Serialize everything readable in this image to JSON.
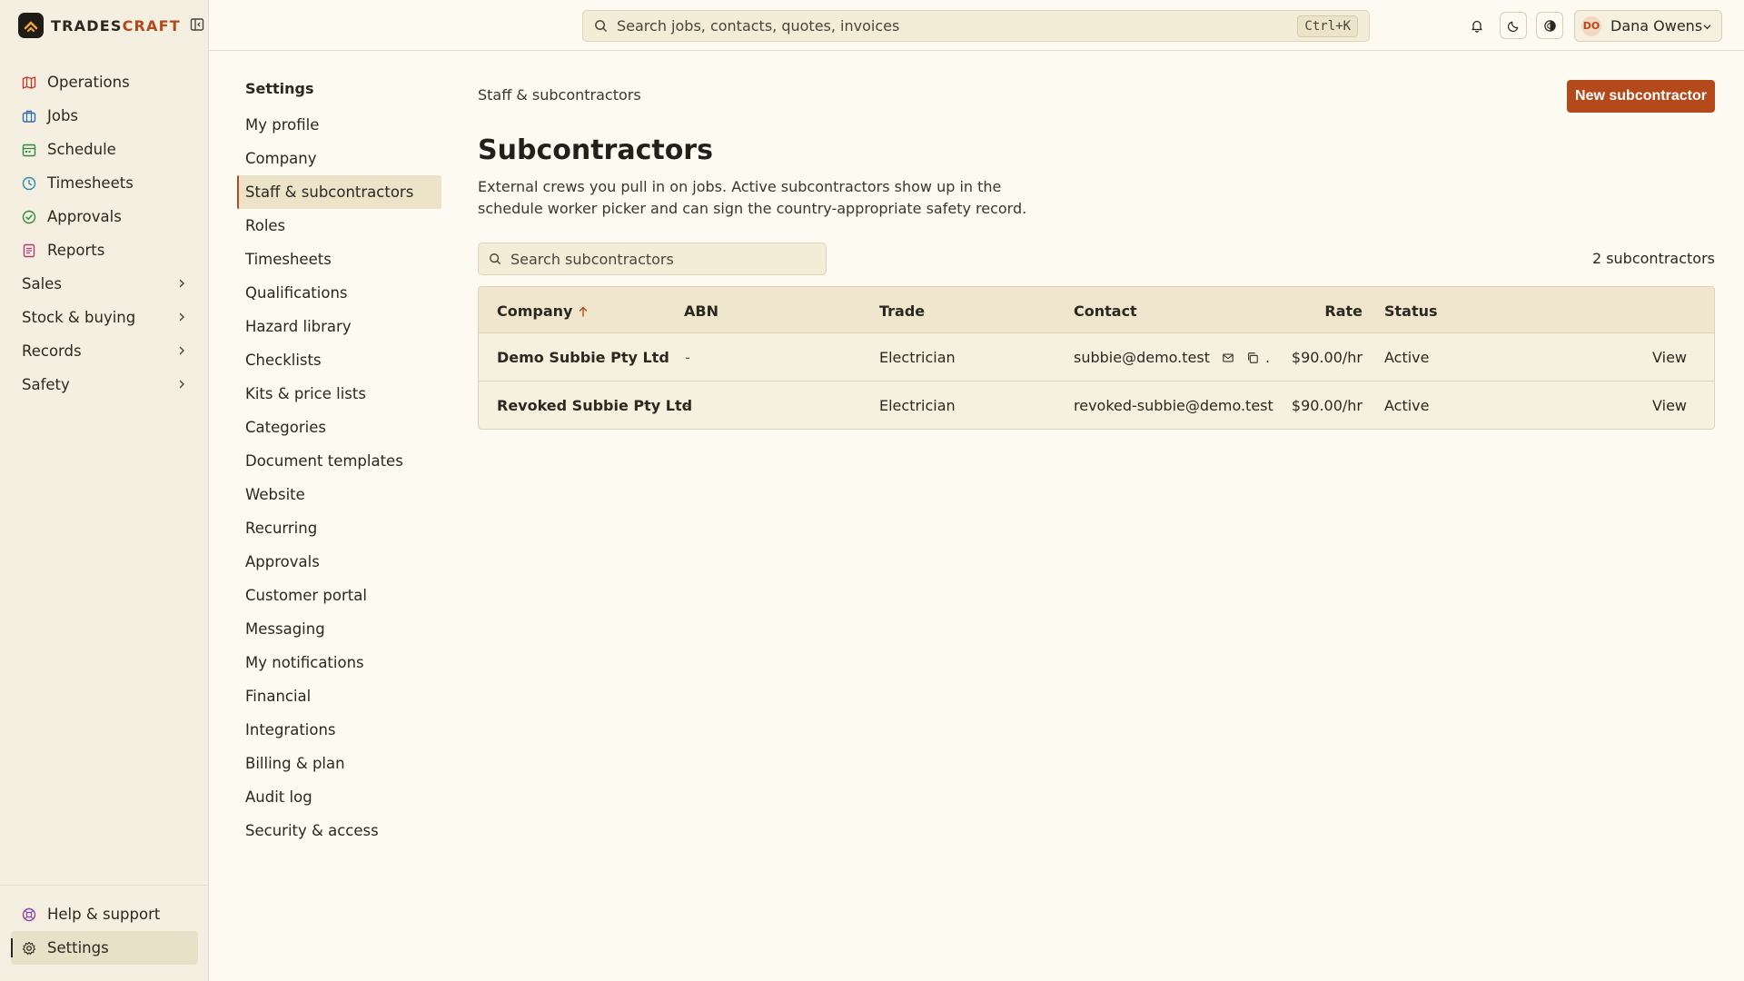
{
  "brand": {
    "name_primary": "TRADES",
    "name_accent": "CRAFT"
  },
  "sidebar": {
    "items": [
      {
        "label": "Operations",
        "icon": "map-icon",
        "color": "#c0392b"
      },
      {
        "label": "Jobs",
        "icon": "briefcase-icon",
        "color": "#2e6fb0"
      },
      {
        "label": "Schedule",
        "icon": "calendar-icon",
        "color": "#2e8b3d"
      },
      {
        "label": "Timesheets",
        "icon": "clock-icon",
        "color": "#2a8ca8"
      },
      {
        "label": "Approvals",
        "icon": "check-circle-icon",
        "color": "#2e8b3d"
      },
      {
        "label": "Reports",
        "icon": "report-icon",
        "color": "#b03a7a"
      },
      {
        "label": "Sales"
      },
      {
        "label": "Stock & buying"
      },
      {
        "label": "Records"
      },
      {
        "label": "Safety"
      }
    ],
    "bottom": [
      {
        "label": "Help & support",
        "icon": "lifebuoy-icon",
        "color": "#8a4bb0"
      },
      {
        "label": "Settings",
        "icon": "gear-icon",
        "color": "#3b372f"
      }
    ]
  },
  "topbar": {
    "search_placeholder": "Search jobs, contacts, quotes, invoices",
    "shortcut": "Ctrl+K",
    "user_initials": "DO",
    "user_name": "Dana Owens"
  },
  "settings_nav": {
    "title": "Settings",
    "items": [
      "My profile",
      "Company",
      "Staff & subcontractors",
      "Roles",
      "Timesheets",
      "Qualifications",
      "Hazard library",
      "Checklists",
      "Kits & price lists",
      "Categories",
      "Document templates",
      "Website",
      "Recurring",
      "Approvals",
      "Customer portal",
      "Messaging",
      "My notifications",
      "Financial",
      "Integrations",
      "Billing & plan",
      "Audit log",
      "Security & access"
    ],
    "active": "Staff & subcontractors"
  },
  "main": {
    "breadcrumb": "Staff & subcontractors",
    "new_button": "New subcontractor",
    "title": "Subcontractors",
    "description": "External crews you pull in on jobs. Active subcontractors show up in the schedule worker picker and can sign the country-appropriate safety record.",
    "search_placeholder": "Search subcontractors",
    "count_label": "2 subcontractors"
  },
  "table": {
    "columns": {
      "company": "Company",
      "abn": "ABN",
      "trade": "Trade",
      "contact": "Contact",
      "rate": "Rate",
      "status": "Status"
    },
    "rows": [
      {
        "company": "Demo Subbie Pty Ltd",
        "abn": "-",
        "trade": "Electrician",
        "contact": "subbie@demo.test",
        "rate": "$90.00/hr",
        "status": "Active",
        "action": "View"
      },
      {
        "company": "Revoked Subbie Pty Ltd",
        "abn": "-",
        "trade": "Electrician",
        "contact": "revoked-subbie@demo.test",
        "rate": "$90.00/hr",
        "status": "Active",
        "action": "View"
      }
    ]
  },
  "colors": {
    "accent": "#b4491b",
    "background": "#fdfaf1",
    "sidebar": "#f4efe0"
  }
}
